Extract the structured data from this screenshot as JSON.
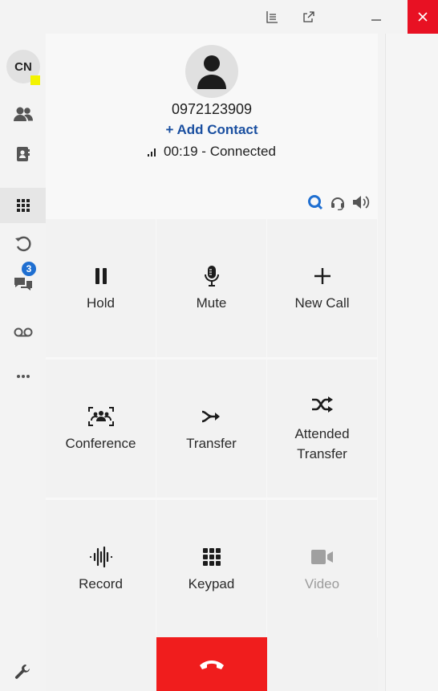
{
  "titlebar": {
    "icons": [
      "list-icon",
      "popout-icon",
      "minimize-icon",
      "close-icon"
    ]
  },
  "sidebar": {
    "avatar_initials": "CN",
    "items": [
      {
        "id": "contacts",
        "icon": "people-icon"
      },
      {
        "id": "address-book",
        "icon": "contact-card-icon"
      },
      {
        "id": "dialpad",
        "icon": "dialpad-icon"
      },
      {
        "id": "history",
        "icon": "history-icon",
        "badge": "3"
      },
      {
        "id": "chat",
        "icon": "chat-icon"
      },
      {
        "id": "voicemail",
        "icon": "voicemail-icon"
      },
      {
        "id": "more",
        "icon": "more-icon"
      }
    ],
    "settings_icon": "wrench-icon"
  },
  "call": {
    "number": "0972123909",
    "add_contact_label": "+ Add Contact",
    "status": "00:19 - Connected"
  },
  "toolbar_icons": [
    "search-icon",
    "headset-icon",
    "speaker-icon"
  ],
  "actions": [
    {
      "label": "Hold",
      "icon": "pause-icon"
    },
    {
      "label": "Mute",
      "icon": "microphone-icon"
    },
    {
      "label": "New Call",
      "icon": "plus-icon"
    },
    {
      "label": "Conference",
      "icon": "conference-icon"
    },
    {
      "label": "Transfer",
      "icon": "transfer-icon"
    },
    {
      "label": "Attended Transfer",
      "icon": "attended-transfer-icon"
    },
    {
      "label": "Record",
      "icon": "waveform-icon"
    },
    {
      "label": "Keypad",
      "icon": "keypad-icon"
    },
    {
      "label": "Video",
      "icon": "video-icon",
      "disabled": true
    }
  ],
  "colors": {
    "accent": "#1a4fa0",
    "badge": "#1f6fd1",
    "hangup": "#f01d1d",
    "close": "#e81123",
    "presence": "#f3f300"
  }
}
